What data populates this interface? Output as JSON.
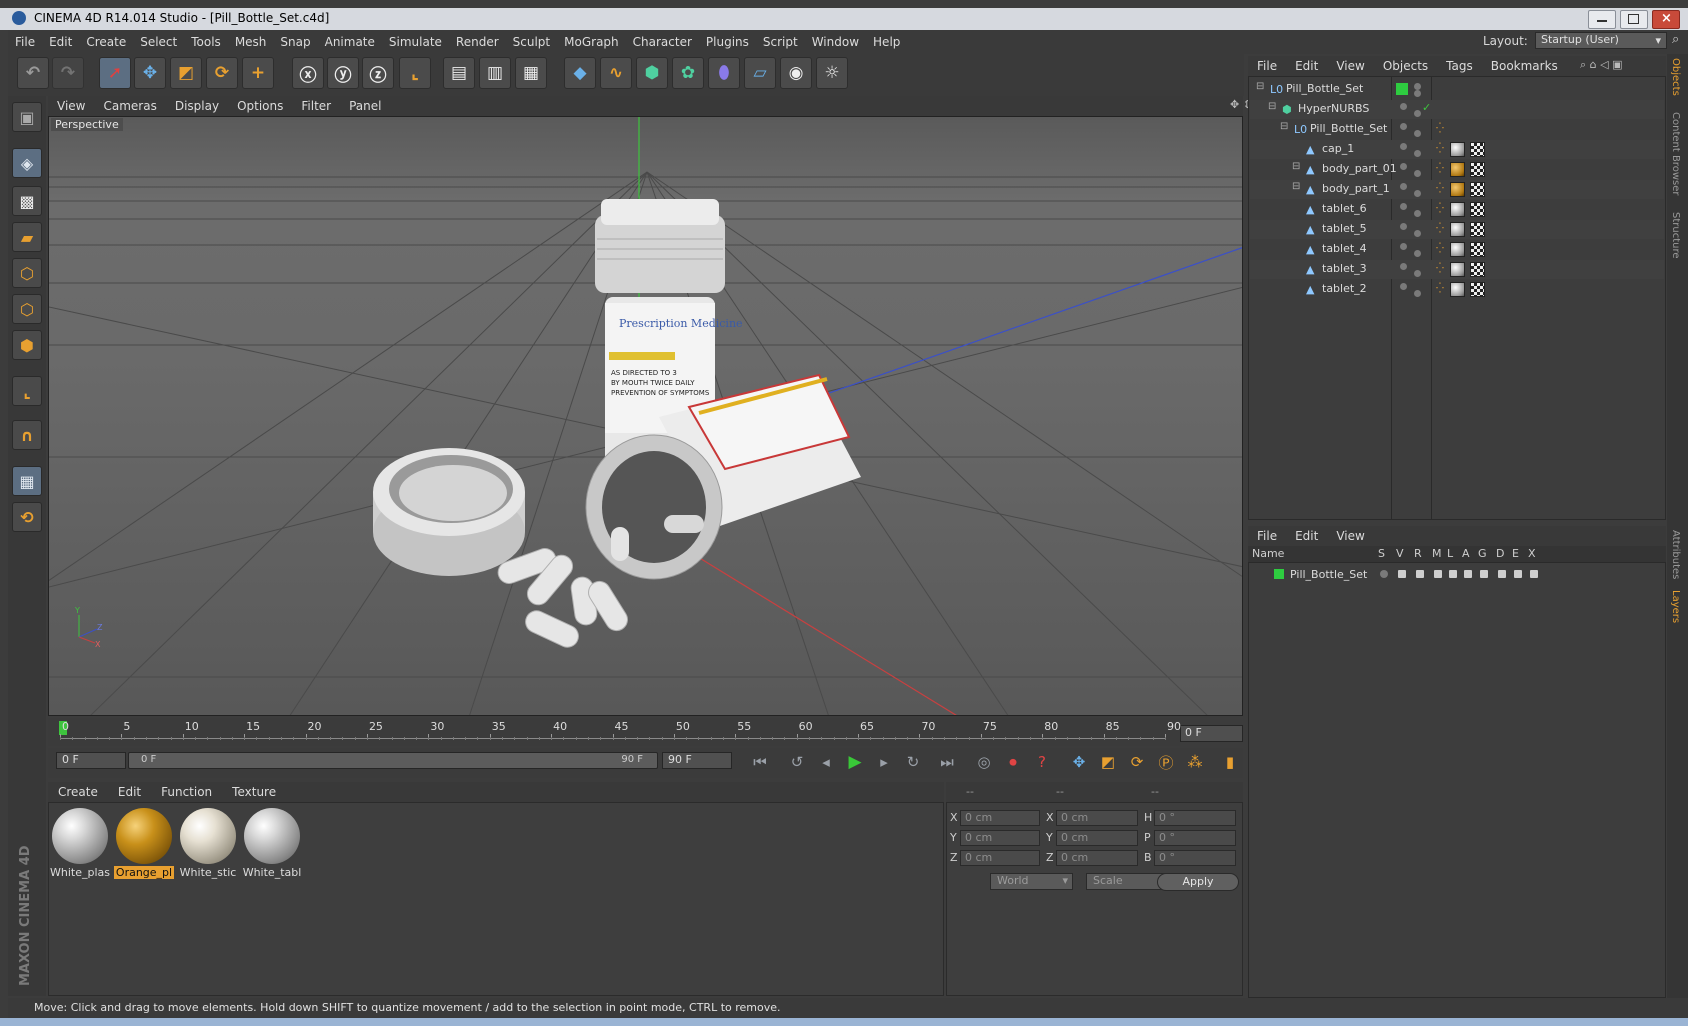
{
  "window": {
    "title": "CINEMA 4D R14.014 Studio - [Pill_Bottle_Set.c4d]"
  },
  "menubar": [
    "File",
    "Edit",
    "Create",
    "Select",
    "Tools",
    "Mesh",
    "Snap",
    "Animate",
    "Simulate",
    "Render",
    "Sculpt",
    "MoGraph",
    "Character",
    "Plugins",
    "Script",
    "Window",
    "Help"
  ],
  "layout": {
    "label": "Layout:",
    "value": "Startup (User)"
  },
  "toolbar": {
    "icons": [
      "undo-icon",
      "redo-icon",
      "live-selection-icon",
      "move-icon",
      "scale-icon",
      "rotate-icon",
      "last-tool-icon",
      "x-axis-icon",
      "y-axis-icon",
      "z-axis-icon",
      "world-coordinates-icon",
      "render-view-icon",
      "render-picture-viewer-icon",
      "edit-render-settings-icon",
      "cube-primitive-icon",
      "spline-icon",
      "nurbs-icon",
      "array-icon",
      "deformer-icon",
      "floor-icon",
      "camera-icon",
      "light-icon"
    ],
    "axis_labels": [
      "X",
      "Y",
      "Z"
    ]
  },
  "viewport": {
    "menu": [
      "View",
      "Cameras",
      "Display",
      "Options",
      "Filter",
      "Panel"
    ],
    "label": "Perspective",
    "axis_gizmo": [
      "Y",
      "Z",
      "X"
    ]
  },
  "bottle_label": {
    "title": "Prescription Medicine",
    "line1": "AS DIRECTED TO 3",
    "line2": "BY MOUTH TWICE DAILY",
    "line3": "PREVENTION OF SYMPTOMS"
  },
  "timeline": {
    "ticks": [
      "0",
      "5",
      "10",
      "15",
      "20",
      "25",
      "30",
      "35",
      "40",
      "45",
      "50",
      "55",
      "60",
      "65",
      "70",
      "75",
      "80",
      "85",
      "90"
    ],
    "current_frame": "0 F",
    "start_frame": "0 F",
    "slider_start": "0 F",
    "slider_end": "90 F",
    "end_frame": "90 F"
  },
  "materials": {
    "menu": [
      "Create",
      "Edit",
      "Function",
      "Texture"
    ],
    "items": [
      {
        "name": "White_plas",
        "kind": "white"
      },
      {
        "name": "Orange_pl",
        "kind": "orange",
        "selected": true
      },
      {
        "name": "White_stic",
        "kind": "label"
      },
      {
        "name": "White_tabl",
        "kind": "white"
      }
    ]
  },
  "coordinates": {
    "headers": [
      "--",
      "--",
      "--"
    ],
    "rows": [
      {
        "l1": "X",
        "v1": "0 cm",
        "l2": "X",
        "v2": "0 cm",
        "l3": "H",
        "v3": "0 °"
      },
      {
        "l1": "Y",
        "v1": "0 cm",
        "l2": "Y",
        "v2": "0 cm",
        "l3": "P",
        "v3": "0 °"
      },
      {
        "l1": "Z",
        "v1": "0 cm",
        "l2": "Z",
        "v2": "0 cm",
        "l3": "B",
        "v3": "0 °"
      }
    ],
    "mode1": "World",
    "mode2": "Scale",
    "apply": "Apply"
  },
  "object_manager": {
    "menu": [
      "File",
      "Edit",
      "View",
      "Objects",
      "Tags",
      "Bookmarks"
    ],
    "objects": [
      {
        "name": "Pill_Bottle_Set",
        "indent": 0,
        "type": "null"
      },
      {
        "name": "HyperNURBS",
        "indent": 1,
        "type": "nurbs"
      },
      {
        "name": "Pill_Bottle_Set",
        "indent": 2,
        "type": "null"
      },
      {
        "name": "cap_1",
        "indent": 3,
        "type": "poly",
        "tag": "w"
      },
      {
        "name": "body_part_01",
        "indent": 3,
        "type": "poly",
        "tag": "o"
      },
      {
        "name": "body_part_1",
        "indent": 3,
        "type": "poly",
        "tag": "o"
      },
      {
        "name": "tablet_6",
        "indent": 3,
        "type": "poly",
        "tag": "w"
      },
      {
        "name": "tablet_5",
        "indent": 3,
        "type": "poly",
        "tag": "w"
      },
      {
        "name": "tablet_4",
        "indent": 3,
        "type": "poly",
        "tag": "w"
      },
      {
        "name": "tablet_3",
        "indent": 3,
        "type": "poly",
        "tag": "w"
      },
      {
        "name": "tablet_2",
        "indent": 3,
        "type": "poly",
        "tag": "w"
      }
    ]
  },
  "layer_manager": {
    "menu": [
      "File",
      "Edit",
      "View"
    ],
    "columns": [
      "Name",
      "S",
      "V",
      "R",
      "M",
      "L",
      "A",
      "G",
      "D",
      "E",
      "X"
    ],
    "layers": [
      {
        "name": "Pill_Bottle_Set",
        "color": "#2ecc40"
      }
    ]
  },
  "side_tabs": [
    "Objects",
    "Content Browser",
    "Structure",
    "Attributes",
    "Layers"
  ],
  "status": "Move: Click and drag to move elements. Hold down SHIFT to quantize movement / add to the selection in point mode, CTRL to remove.",
  "brand": "MAXON CINEMA 4D",
  "colors": {
    "accent": "#e8a030",
    "selection": "#5c6e82",
    "play": "#39c838"
  }
}
